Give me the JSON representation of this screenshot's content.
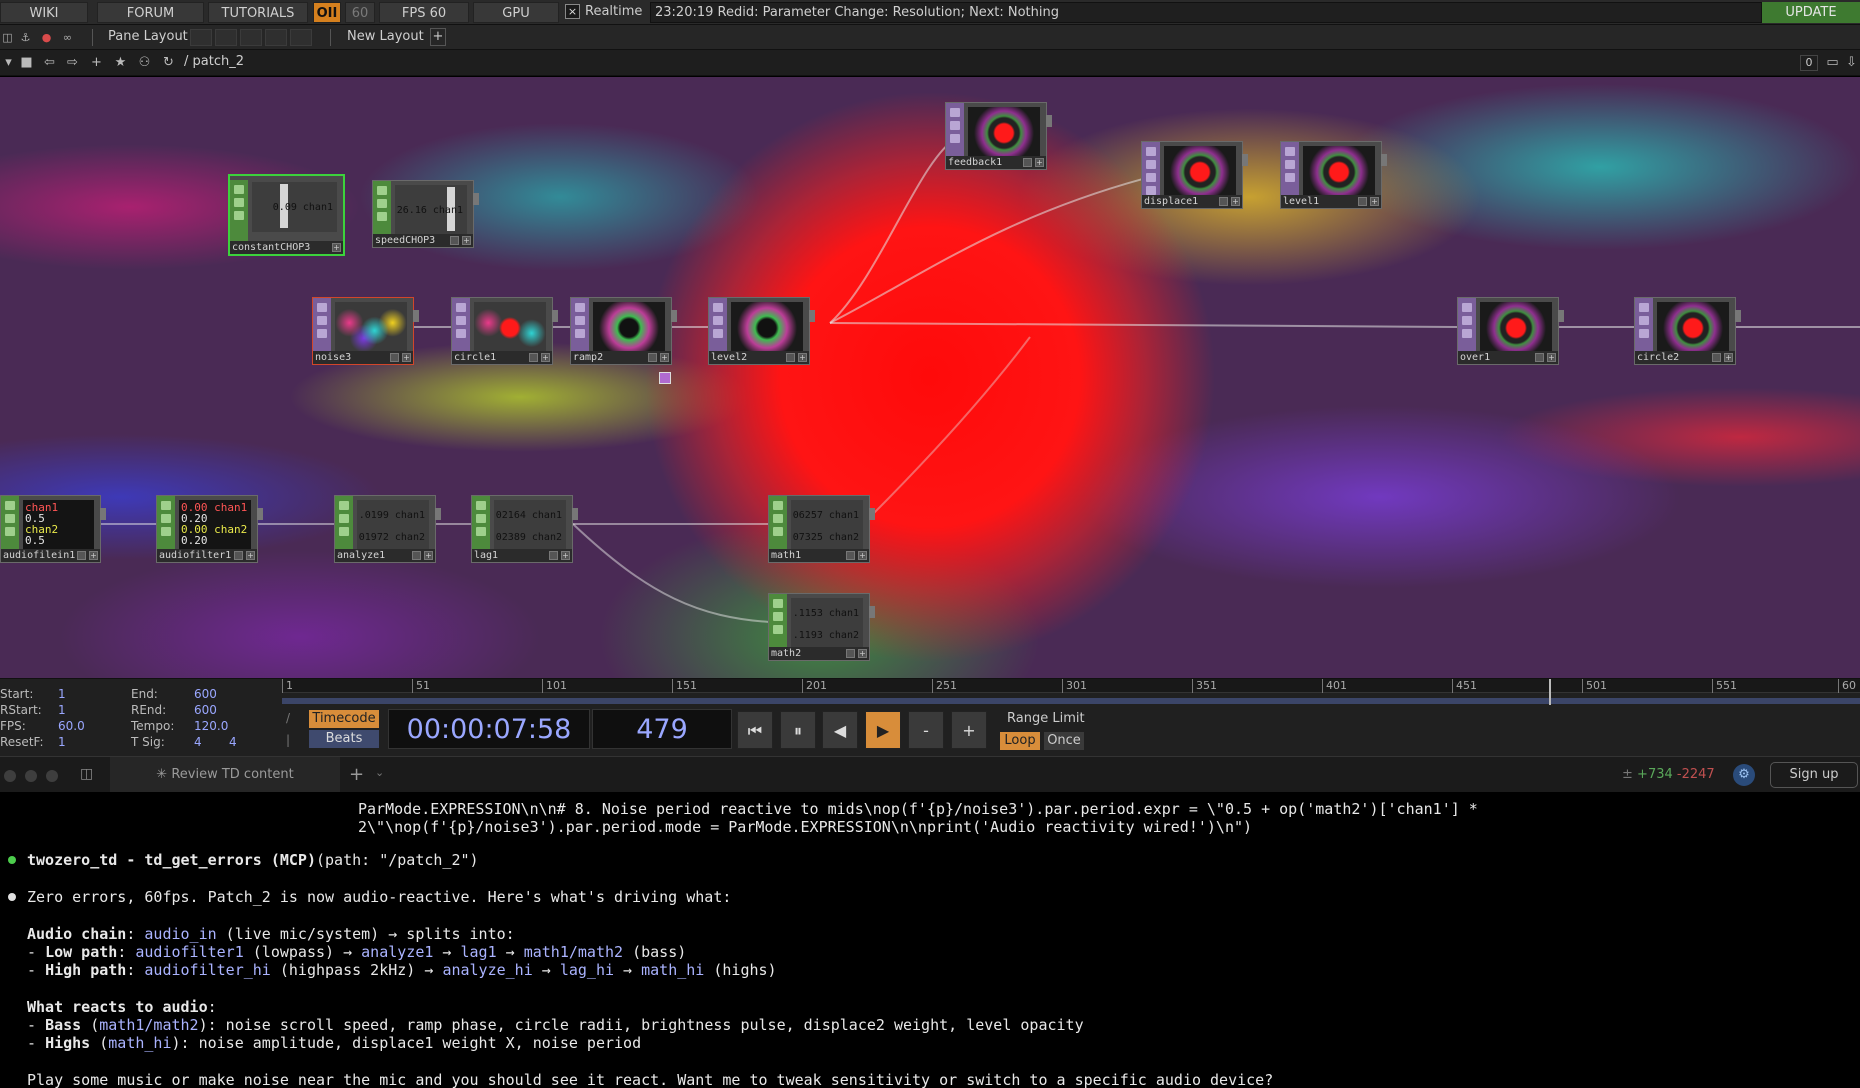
{
  "menubar": {
    "wiki": "WIKI",
    "forum": "FORUM",
    "tutorials": "TUTORIALS",
    "oii": "OII",
    "rate": "60",
    "fps": "FPS  60",
    "gpu": "GPU",
    "realtime_check": "×",
    "realtime": "Realtime",
    "status": "23:20:19 Redid: Parameter Change: Resolution; Next: Nothing",
    "update": "UPDATE"
  },
  "panebar": {
    "pane_layout": "Pane Layout",
    "new_layout": "New Layout",
    "add": "+"
  },
  "pathbar": {
    "path": "/ patch_2",
    "counter": "0"
  },
  "nodes": {
    "feedback1": "feedback1",
    "displace1": "displace1",
    "level1": "level1",
    "constantCHOP3": "constantCHOP3",
    "constantCHOP3_val": "0.09 chan1",
    "speedCHOP3": "speedCHOP3",
    "speedCHOP3_val": "26.16 chan1",
    "noise3": "noise3",
    "circle1": "circle1",
    "ramp2": "ramp2",
    "level2": "level2",
    "over1": "over1",
    "circle2": "circle2",
    "audiofilein1": "audiofilein1",
    "audiofilein1_l1": "chan1",
    "audiofilein1_l2": "0.5",
    "audiofilein1_l3": "chan2",
    "audiofilein1_l4": "0.5",
    "audiofilter1": "audiofilter1",
    "audiofilter1_l1": "0.00 chan1",
    "audiofilter1_l2": "0.20",
    "audiofilter1_l3": "0.00 chan2",
    "audiofilter1_l4": "0.20",
    "analyze1": "analyze1",
    "analyze1_c1": ".0199 chan1",
    "analyze1_c2": "01972 chan2",
    "lag1": "lag1",
    "lag1_c1": "02164 chan1",
    "lag1_c2": "02389 chan2",
    "math1": "math1",
    "math1_c1": "06257 chan1",
    "math1_c2": "07325 chan2",
    "math2": "math2",
    "math2_c1": ".1153 chan1",
    "math2_c2": ".1193 chan2"
  },
  "timeline": {
    "start_label": "Start:",
    "start_val": "1",
    "rstart_label": "RStart:",
    "rstart_val": "1",
    "fps_label": "FPS:",
    "fps_val": "60.0",
    "resetf_label": "ResetF:",
    "resetf_val": "1",
    "end_label": "End:",
    "end_val": "600",
    "rend_label": "REnd:",
    "rend_val": "600",
    "tempo_label": "Tempo:",
    "tempo_val": "120.0",
    "tsig_label": "T Sig:",
    "tsig_val1": "4",
    "tsig_val2": "4",
    "ruler": [
      "1",
      "51",
      "101",
      "151",
      "201",
      "251",
      "301",
      "351",
      "401",
      "451",
      "501",
      "551",
      "60"
    ],
    "timecode": "Timecode",
    "beats": "Beats",
    "tc_value": "00:00:07:58",
    "frame_value": "479",
    "minus": "-",
    "plus": "+",
    "range_limit": "Range Limit",
    "loop": "Loop",
    "once": "Once"
  },
  "tabbar": {
    "tab": "✳ Review TD content",
    "new_tab": "+",
    "diff_add": "+734",
    "diff_del": "-2247",
    "signup": "Sign up"
  },
  "terminal": {
    "code_line1": "ParMode.EXPRESSION\\n\\n# 8. Noise period reactive to mids\\nop(f'{p}/noise3').par.period.expr = \\\"0.5 + op('math2')['chan1'] *",
    "code_line2": "2\\\"\\nop(f'{p}/noise3').par.period.mode = ParMode.EXPRESSION\\n\\nprint('Audio reactivity wired!')\\n\")",
    "tool_name": "twozero_td - td_get_errors (MCP)",
    "tool_args": "(path: \"/patch_2\")",
    "summary": "Zero errors, 60fps. Patch_2 is now audio-reactive. Here's what's driving what:",
    "chain_title": "Audio chain",
    "chain_a": ": ",
    "chain_b": "audio_in",
    "chain_c": " (live mic/system) → splits into:",
    "low_dash": "- ",
    "low_title": "Low path",
    "low_a": ": ",
    "low_b": "audiofilter1",
    "low_c": " (lowpass) → ",
    "low_d": "analyze1",
    "low_e": " → ",
    "low_f": "lag1",
    "low_g": " → ",
    "low_h": "math1/math2",
    "low_i": " (bass)",
    "high_dash": "- ",
    "high_title": "High path",
    "high_a": ": ",
    "high_b": "audiofilter_hi",
    "high_c": " (highpass 2kHz) → ",
    "high_d": "analyze_hi",
    "high_e": " → ",
    "high_f": "lag_hi",
    "high_g": " → ",
    "high_h": "math_hi",
    "high_i": " (highs)",
    "reacts_title": "What reacts to audio",
    "reacts_colon": ":",
    "bass_dash": "- ",
    "bass_title": "Bass",
    "bass_a": " (",
    "bass_b": "math1/math2",
    "bass_c": "): noise scroll speed, ramp phase, circle radii, brightness pulse, displace2 weight, level opacity",
    "highs_dash": "- ",
    "highs_title": "Highs",
    "highs_a": " (",
    "highs_b": "math_hi",
    "highs_c": "): noise amplitude, displace1 weight X, noise period",
    "closing": "Play some music or make noise near the mic and you should see it react. Want me to tweak sensitivity or switch to a specific audio device?"
  },
  "colors": {
    "accent_orange": "#d88d3a",
    "update_green": "#3e7a30",
    "value_blue": "#9aa7ff",
    "selected_green": "#3cd23c",
    "diff_green": "#5aa85a",
    "diff_red": "#c05050"
  }
}
